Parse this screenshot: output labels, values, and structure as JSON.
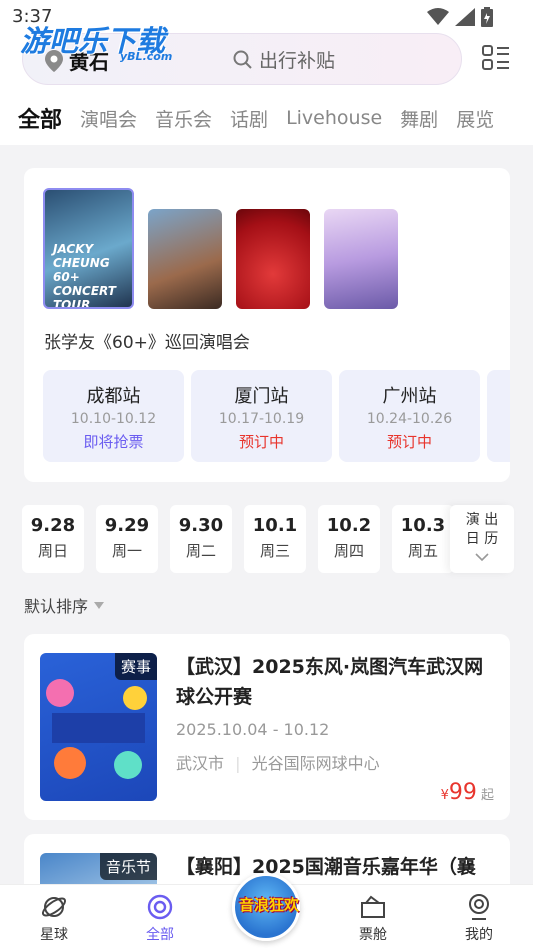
{
  "status": {
    "time": "3:37"
  },
  "watermark": {
    "text": "游吧乐下载",
    "sub": "yBL.com"
  },
  "header": {
    "location": "黄石",
    "search_text": "出行补贴"
  },
  "tabs": [
    "全部",
    "演唱会",
    "音乐会",
    "话剧",
    "Livehouse",
    "舞剧",
    "展览"
  ],
  "featured": {
    "title": "张学友《60+》巡回演唱会",
    "poster_text": "JACKY CHEUNG 60+ CONCERT TOUR",
    "stops": [
      {
        "city": "成都站",
        "dates": "10.10-10.12",
        "status": "即将抢票",
        "color": "#6a5cf0"
      },
      {
        "city": "厦门站",
        "dates": "10.17-10.19",
        "status": "预订中",
        "color": "#e8352d"
      },
      {
        "city": "广州站",
        "dates": "10.24-10.26",
        "status": "预订中",
        "color": "#e8352d"
      }
    ]
  },
  "dates": [
    {
      "num": "9.28",
      "wd": "周日"
    },
    {
      "num": "9.29",
      "wd": "周一"
    },
    {
      "num": "9.30",
      "wd": "周二"
    },
    {
      "num": "10.1",
      "wd": "周三"
    },
    {
      "num": "10.2",
      "wd": "周四"
    },
    {
      "num": "10.3",
      "wd": "周五"
    }
  ],
  "calendar": {
    "line1": "演 出",
    "line2": "日 历"
  },
  "sort": {
    "label": "默认排序"
  },
  "events": [
    {
      "badge": "赛事",
      "title": "【武汉】2025东风·岚图汽车武汉网球公开赛",
      "date": "2025.10.04 - 10.12",
      "city": "武汉市",
      "venue": "光谷国际网球中心",
      "currency": "¥",
      "price": "99",
      "price_suffix": "起"
    },
    {
      "badge": "音乐节",
      "title": "【襄阳】2025国潮音乐嘉年华（襄"
    }
  ],
  "bottom_nav": [
    {
      "label": "星球"
    },
    {
      "label": "全部"
    },
    {
      "label": "音浪狂欢"
    },
    {
      "label": "票舱"
    },
    {
      "label": "我的"
    }
  ],
  "colors": {
    "accent": "#6a5cf0",
    "price": "#e8352d"
  }
}
